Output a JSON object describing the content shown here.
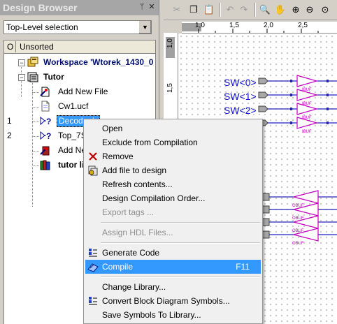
{
  "browser": {
    "title": "Design Browser",
    "scope": "Top-Level selection",
    "header": {
      "col_o": "O",
      "col_name": "Unsorted"
    },
    "rows": [
      {
        "num": "",
        "label": "Workspace 'Wtorek_1430_0"
      },
      {
        "num": "",
        "label": "Tutor"
      },
      {
        "num": "",
        "label": "Add New File"
      },
      {
        "num": "",
        "label": "Cw1.ucf"
      },
      {
        "num": "1",
        "label": "Decoder.bde"
      },
      {
        "num": "2",
        "label": "Top_7S"
      },
      {
        "num": "",
        "label": "Add Ne"
      },
      {
        "num": "",
        "label": "tutor li"
      }
    ]
  },
  "ruler": {
    "h_ticks": [
      "1,0",
      "1,5",
      "2,0",
      "2,5"
    ],
    "v_ticks": [
      "1,0",
      "1,5"
    ]
  },
  "schematic": {
    "inputs": [
      "SW<0>",
      "SW<1>",
      "SW<2>"
    ],
    "ibuf_label": "IBUF",
    "obuf_label": "OBUF"
  },
  "menu": {
    "items": [
      {
        "label": "Open",
        "shortcut": "",
        "disabled": false
      },
      {
        "label": "Exclude from Compilation",
        "shortcut": "",
        "disabled": false
      },
      {
        "label": "Remove",
        "shortcut": "",
        "disabled": false
      },
      {
        "label": "Add file to design",
        "shortcut": "",
        "disabled": false
      },
      {
        "label": "Refresh contents...",
        "shortcut": "",
        "disabled": false
      },
      {
        "label": "Design Compilation Order...",
        "shortcut": "",
        "disabled": false
      },
      {
        "label": "Export tags ...",
        "shortcut": "",
        "disabled": true
      },
      {
        "label": "Assign HDL Files...",
        "shortcut": "",
        "disabled": true
      },
      {
        "label": "Generate Code",
        "shortcut": "",
        "disabled": false
      },
      {
        "label": "Compile",
        "shortcut": "F11",
        "disabled": false,
        "selected": true
      },
      {
        "label": "Change Library...",
        "shortcut": "",
        "disabled": false
      },
      {
        "label": "Convert Block Diagram Symbols...",
        "shortcut": "",
        "disabled": false
      },
      {
        "label": "Save Symbols To Library...",
        "shortcut": "",
        "disabled": false
      }
    ]
  },
  "colors": {
    "selection": "#3399ff",
    "wire": "#2020c0",
    "buffer": "#c000c0",
    "input_label": "#1010d0"
  }
}
